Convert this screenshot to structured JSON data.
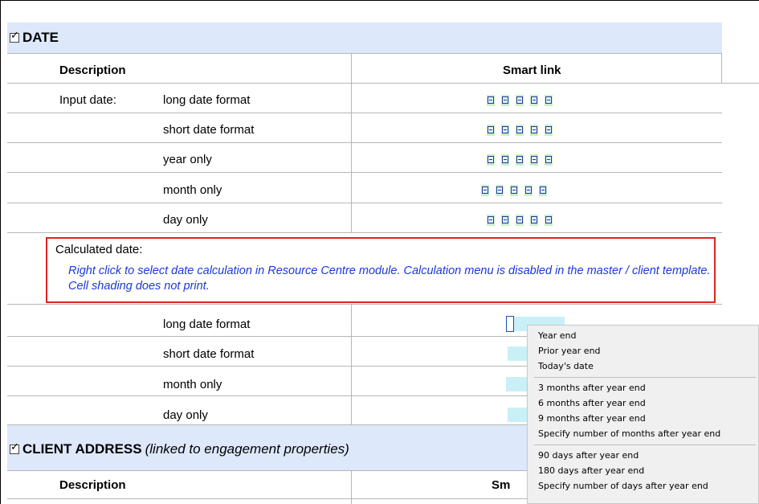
{
  "date_section": {
    "title": "DATE",
    "columns": {
      "description": "Description",
      "smart_link": "Smart link"
    },
    "input_rows": [
      {
        "group_label": "Input date:",
        "label": "long date format"
      },
      {
        "group_label": "",
        "label": "short date format"
      },
      {
        "group_label": "",
        "label": "year only"
      },
      {
        "group_label": "",
        "label": "month only"
      },
      {
        "group_label": "",
        "label": "day only"
      }
    ],
    "callout": {
      "title": "Calculated date:",
      "note": "Right click to select date calculation in Resource Centre module. Calculation menu is disabled in the master / client template. Cell shading does not print."
    },
    "calc_rows": [
      {
        "label": "long date format"
      },
      {
        "label": "short date format"
      },
      {
        "label": "month only"
      },
      {
        "label": "day only"
      }
    ]
  },
  "client_section": {
    "title": "CLIENT ADDRESS",
    "subtitle": "(linked to engagement properties)",
    "columns": {
      "description": "Description",
      "smart_link": "Sm"
    }
  },
  "context_menu": {
    "groups": [
      [
        "Year end",
        "Prior year end",
        "Today's date"
      ],
      [
        "3 months after year end",
        "6 months after year end",
        "9 months after year end",
        "Specify number of months after year end"
      ],
      [
        "90 days after year end",
        "180 days after year end",
        "Specify number of days after year end"
      ]
    ]
  },
  "colors": {
    "section_band": "#dde8fb",
    "smart_link_cell": "#c9efc9",
    "calc_cell": "#c9f0f7",
    "callout_border": "#e02222",
    "note_text": "#1d37d8"
  },
  "icons": {
    "checkbox": "checked-checkbox-icon",
    "smart_link": "field-link-icon"
  }
}
